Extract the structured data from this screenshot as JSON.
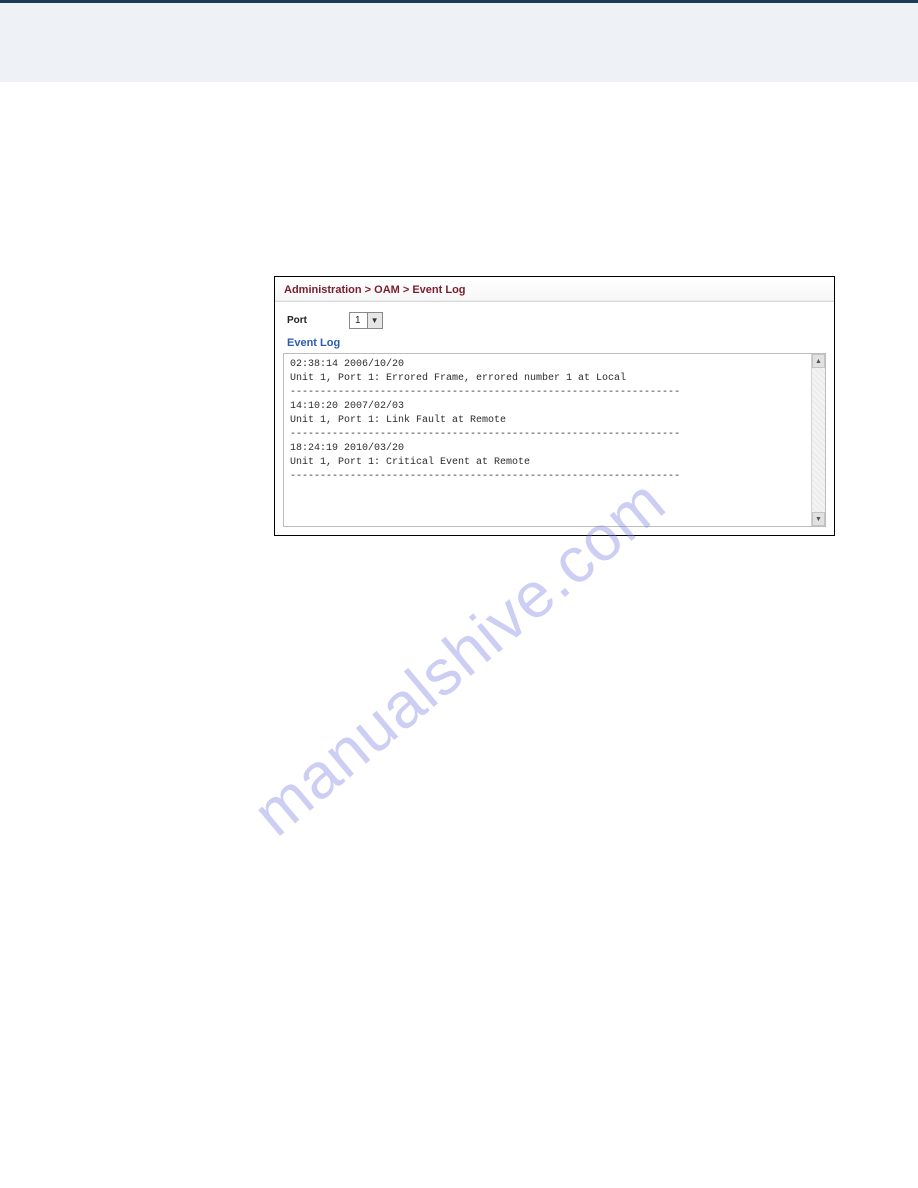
{
  "breadcrumb": "Administration > OAM > Event Log",
  "port": {
    "label": "Port",
    "value": "1"
  },
  "section_title": "Event Log",
  "log_entries": [
    "02:38:14 2006/10/20",
    "Unit 1, Port 1: Errored Frame, errored number 1 at Local",
    "-----------------------------------------------------------------",
    "14:10:20 2007/02/03",
    "Unit 1, Port 1: Link Fault at Remote",
    "-----------------------------------------------------------------",
    "18:24:19 2010/03/20",
    "Unit 1, Port 1: Critical Event at Remote",
    "-----------------------------------------------------------------"
  ],
  "watermark": "manualshive.com"
}
